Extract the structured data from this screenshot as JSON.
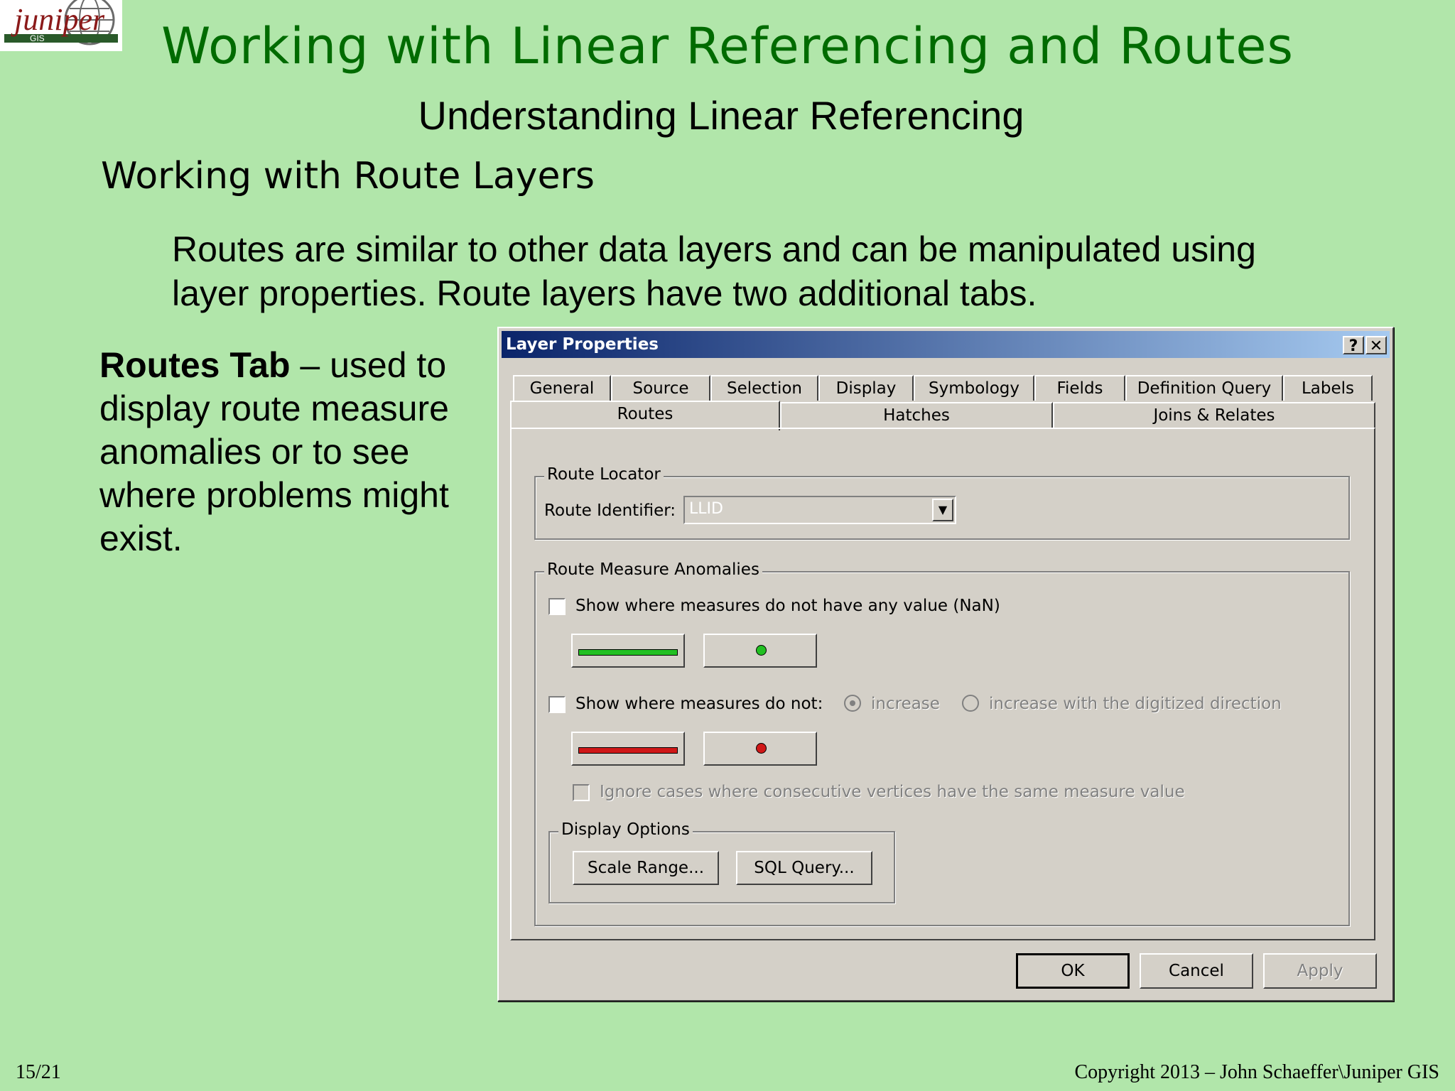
{
  "slide": {
    "logo_text": "juniper",
    "logo_sub": "GIS",
    "title": "Working with Linear Referencing and Routes",
    "subtitle": "Understanding Linear Referencing",
    "section": "Working with Route Layers",
    "intro_line1": "Routes are similar to other data layers and can be manipulated using",
    "intro_line2": "layer properties. Route layers have two additional tabs.",
    "routes_bold": "Routes Tab",
    "routes_desc": " – used to display route measure anomalies or to see where problems might exist.",
    "page": "15/21",
    "copyright": "Copyright 2013 – John Schaeffer\\Juniper GIS"
  },
  "dialog": {
    "title": "Layer Properties",
    "help_label": "?",
    "close_label": "✕",
    "tabs_row1": [
      "General",
      "Source",
      "Selection",
      "Display",
      "Symbology",
      "Fields",
      "Definition Query",
      "Labels"
    ],
    "tabs_row2": [
      "Routes",
      "Hatches",
      "Joins & Relates"
    ],
    "active_tab": "Routes",
    "route_locator": {
      "legend": "Route Locator",
      "identifier_label": "Route Identifier:",
      "identifier_value": "LLID"
    },
    "anomalies": {
      "legend": "Route Measure Anomalies",
      "nan_label": "Show where measures do not have any value (NaN)",
      "nan_line_color": "#22c022",
      "nan_point_color": "#22c022",
      "notincrease_label": "Show where measures do not:",
      "radio_increase": "increase",
      "radio_digitized": "increase with the digitized direction",
      "notincrease_line_color": "#d01818",
      "notincrease_point_color": "#d01818",
      "ignore_label": "Ignore cases where consecutive vertices have the same measure value"
    },
    "display_options": {
      "legend": "Display Options",
      "scale_range": "Scale Range...",
      "sql_query": "SQL Query..."
    },
    "buttons": {
      "ok": "OK",
      "cancel": "Cancel",
      "apply": "Apply"
    }
  }
}
